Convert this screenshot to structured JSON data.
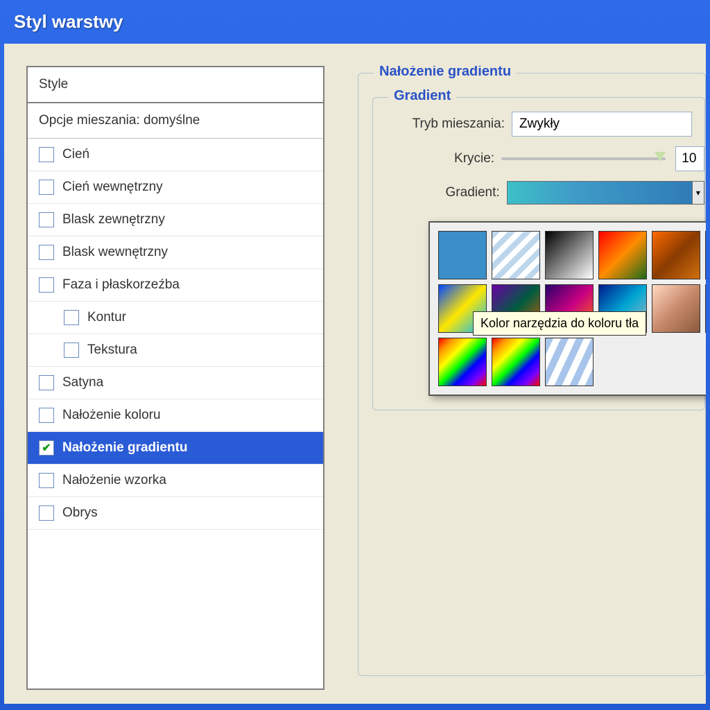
{
  "window": {
    "title": "Styl warstwy"
  },
  "styles": {
    "heading": "Style",
    "blend_defaults": "Opcje mieszania: domyślne",
    "effects": [
      {
        "key": "drop-shadow",
        "label": "Cień"
      },
      {
        "key": "inner-shadow",
        "label": "Cień wewnętrzny"
      },
      {
        "key": "outer-glow",
        "label": "Blask zewnętrzny"
      },
      {
        "key": "inner-glow",
        "label": "Blask wewnętrzny"
      },
      {
        "key": "bevel",
        "label": "Faza i płaskorzeźba"
      },
      {
        "key": "contour",
        "label": "Kontur",
        "indent": true
      },
      {
        "key": "texture",
        "label": "Tekstura",
        "indent": true
      },
      {
        "key": "satin",
        "label": "Satyna"
      },
      {
        "key": "color-overlay",
        "label": "Nałożenie koloru"
      },
      {
        "key": "gradient-overlay",
        "label": "Nałożenie gradientu",
        "checked": true,
        "selected": true
      },
      {
        "key": "pattern-overlay",
        "label": "Nałożenie wzorka"
      },
      {
        "key": "stroke",
        "label": "Obrys"
      }
    ]
  },
  "panel": {
    "title": "Nałożenie gradientu",
    "group": "Gradient",
    "blend_label": "Tryb mieszania:",
    "blend_value": "Zwykły",
    "opacity_label": "Krycie:",
    "opacity_value": "10",
    "gradient_label": "Gradient:",
    "tooltip": "Kolor narzędzia do koloru tła"
  }
}
